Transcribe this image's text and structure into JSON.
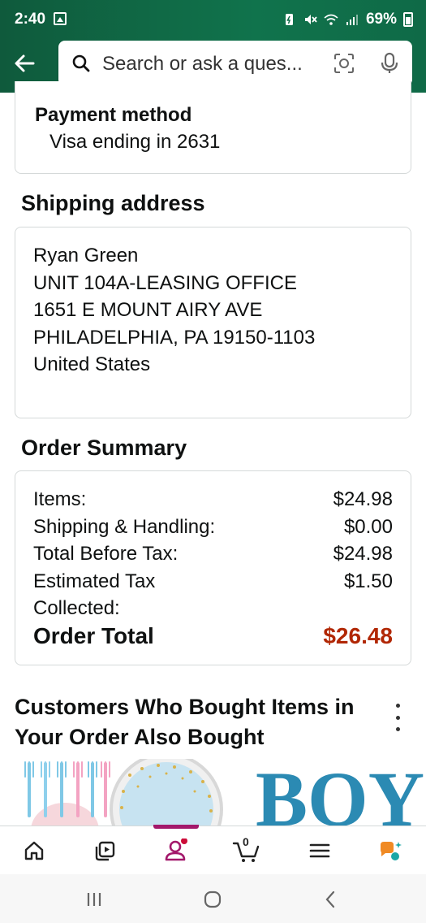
{
  "status_bar": {
    "time": "2:40",
    "battery": "69%"
  },
  "search": {
    "placeholder": "Search or ask a ques..."
  },
  "payment": {
    "label": "Payment method",
    "value": "Visa ending in 2631"
  },
  "shipping": {
    "title": "Shipping address",
    "lines": [
      "Ryan Green",
      "UNIT 104A-LEASING OFFICE",
      "1651 E MOUNT AIRY AVE",
      "PHILADELPHIA, PA 19150-1103",
      "United States"
    ]
  },
  "order_summary": {
    "title": "Order Summary",
    "rows": [
      {
        "label": "Items:",
        "value": "$24.98"
      },
      {
        "label": "Shipping & Handling:",
        "value": "$0.00"
      },
      {
        "label": "Total Before Tax:",
        "value": "$24.98"
      },
      {
        "label": "Estimated Tax",
        "value": "$1.50"
      },
      {
        "label": "Collected:",
        "value": ""
      }
    ],
    "total_label": "Order Total",
    "total_value": "$26.48"
  },
  "also_bought": {
    "title": "Customers Who Bought Items in Your Order Also Bought",
    "product_text": "BOY"
  },
  "bottom_nav": {
    "cart_count": "0",
    "items": [
      "home-icon",
      "video-icon",
      "account-icon",
      "cart-icon",
      "menu-icon",
      "rufus-icon"
    ]
  },
  "colors": {
    "header_green": "#10734c",
    "price_red": "#b12704",
    "active_nav": "#a3186b"
  }
}
